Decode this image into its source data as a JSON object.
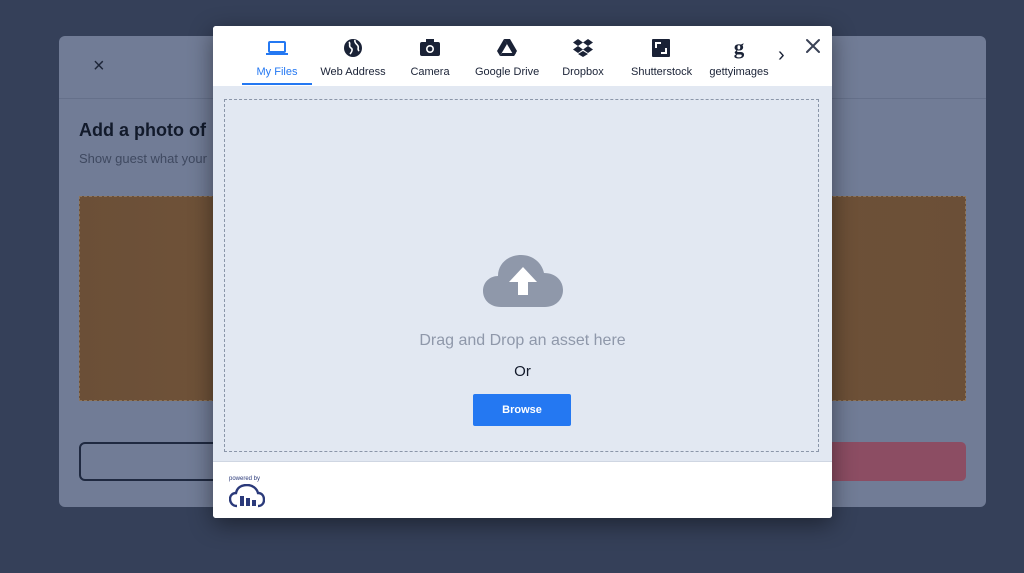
{
  "background_modal": {
    "close_glyph": "×",
    "title": "Add a photo of",
    "subtitle": "Show guest what your"
  },
  "widget": {
    "tabs": [
      {
        "label": "My Files",
        "icon": "laptop-icon",
        "active": true
      },
      {
        "label": "Web Address",
        "icon": "globe-icon",
        "active": false
      },
      {
        "label": "Camera",
        "icon": "camera-icon",
        "active": false
      },
      {
        "label": "Google Drive",
        "icon": "google-drive-icon",
        "active": false
      },
      {
        "label": "Dropbox",
        "icon": "dropbox-icon",
        "active": false
      },
      {
        "label": "Shutterstock",
        "icon": "shutterstock-icon",
        "active": false
      },
      {
        "label": "gettyimages",
        "icon": "gettyimages-icon",
        "active": false
      }
    ],
    "next_glyph": "›",
    "drop_text": "Drag and Drop an asset here",
    "or_text": "Or",
    "browse_label": "Browse",
    "powered_by": "powered by",
    "colors": {
      "accent": "#2478f2",
      "drop_bg": "#e2e8f2",
      "overlay_bg": "#354059"
    }
  }
}
